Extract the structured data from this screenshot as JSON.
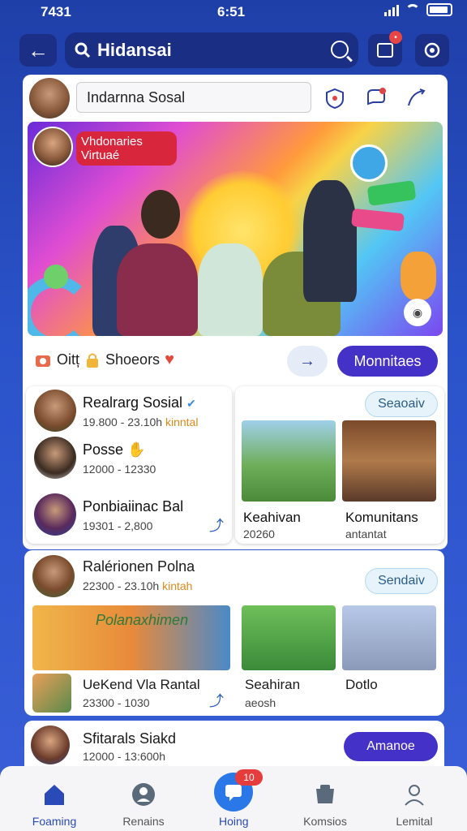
{
  "status_bar": {
    "time_left": "7431",
    "time_center": "6:51"
  },
  "header": {
    "back_icon": "arrow-left-icon",
    "search_title": "Hidansai"
  },
  "composer": {
    "placeholder": "Indarnna Sosal"
  },
  "banner": {
    "label_line1": "Vhdonaries",
    "label_line2": "Virtuaé"
  },
  "meta_row": {
    "label_1": "Oitț",
    "label_2": "Shoeors",
    "primary_button": "Monnitaes"
  },
  "list_card": {
    "rows": [
      {
        "name": "Realrarg Sosial",
        "meta": "19.800 - 23.10h",
        "meta_accent": "kinntal"
      },
      {
        "name": "Posse",
        "meta": "12000 - 12330",
        "meta_accent": ""
      },
      {
        "name": "Ponbiaiinac Bal",
        "meta": "19301 - 2,800",
        "meta_accent": ""
      }
    ],
    "follow_button": "Seaoaiv"
  },
  "photo_card": {
    "items": [
      {
        "caption": "Keahivan",
        "sub": "20260"
      },
      {
        "caption": "Komunitans",
        "sub": "antantat"
      }
    ]
  },
  "card_2": {
    "header_name": "Ralérionen Polna",
    "header_meta": "22300 - 23.10h",
    "header_meta_accent": "kintah",
    "follow_button": "Sendaiv",
    "big_photo_title": "Polanaxhimen",
    "big_photo_caption": "UeKend Vla Rantal",
    "big_photo_meta": "23300 - 1030",
    "photo_1_caption": "Seahiran",
    "photo_1_sub": "aeosh",
    "photo_2_caption": "Dotlo"
  },
  "card_3": {
    "name": "Sfitarals Siakd",
    "meta": "12000 - 13:600h",
    "button": "Amanoe"
  },
  "bottom_nav": {
    "items": [
      {
        "label": "Foaming"
      },
      {
        "label": "Renains"
      },
      {
        "label": "Hoing"
      },
      {
        "label": "Komsios"
      },
      {
        "label": "Lemital"
      }
    ],
    "badge": "10"
  }
}
